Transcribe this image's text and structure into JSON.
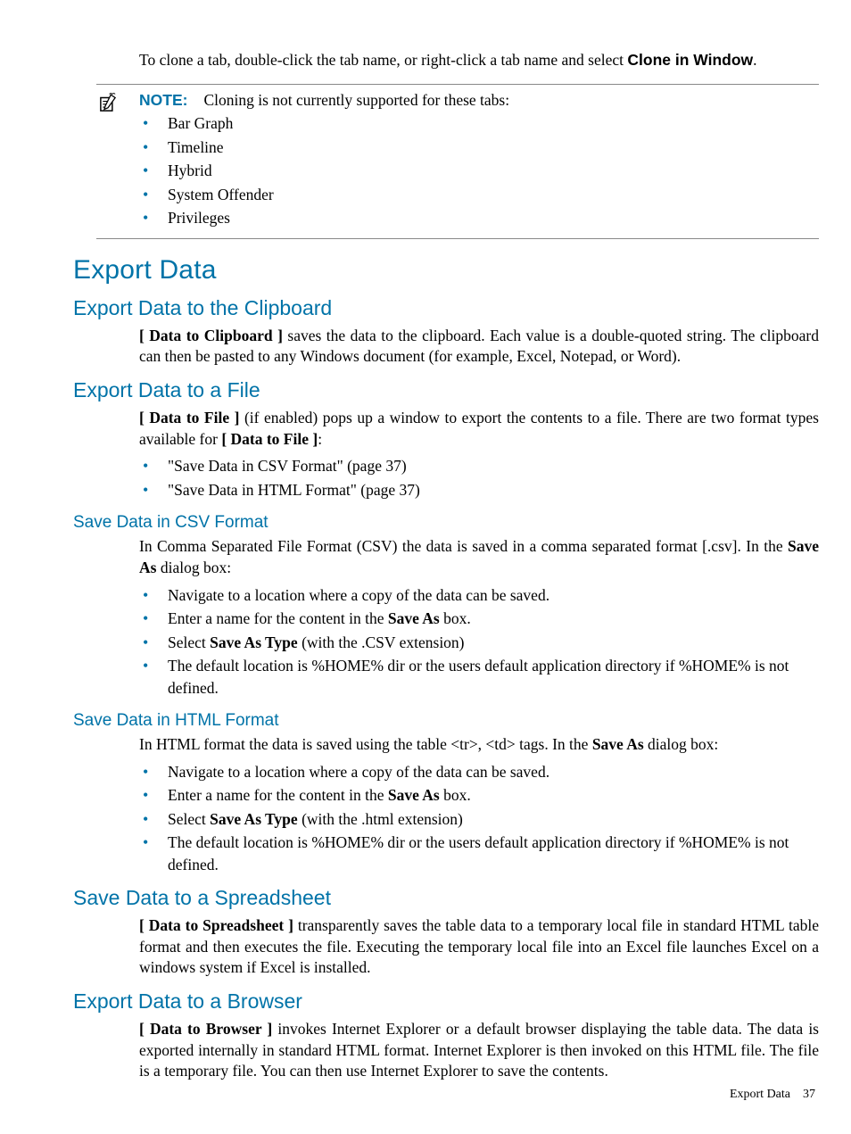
{
  "intro": {
    "prefix": "To clone a tab, double-click the tab name, or right-click a tab name and select ",
    "bold": "Clone in Window",
    "suffix": "."
  },
  "note": {
    "label": "NOTE:",
    "text": "Cloning is not currently supported for these tabs:",
    "items": [
      "Bar Graph",
      "Timeline",
      "Hybrid",
      "System Offender",
      "Privileges"
    ]
  },
  "h1_export": "Export Data",
  "clipboard": {
    "heading": "Export Data to the Clipboard",
    "bold": "[ Data to Clipboard ]",
    "rest": " saves the data to the clipboard. Each value is a double-quoted string. The clipboard can then be pasted to any Windows document (for example, Excel, Notepad, or Word)."
  },
  "file": {
    "heading": "Export Data to a File",
    "p_bold1": "[ Data to File ]",
    "p_mid": " (if enabled) pops up a window to export the contents to a file. There are two format types available for ",
    "p_bold2": "[ Data to File ]",
    "p_suffix": ":",
    "items": [
      "\"Save Data in CSV Format\" (page 37)",
      "\"Save Data in HTML Format\" (page 37)"
    ]
  },
  "csv": {
    "heading": "Save Data in CSV Format",
    "p_pre": "In Comma Separated File Format (CSV) the data is saved in a comma separated format [.csv]. In the ",
    "p_bold": "Save As",
    "p_post": " dialog box:",
    "items": {
      "i0": "Navigate to a location where a copy of the data can be saved.",
      "i1_pre": "Enter a name for the content in the ",
      "i1_bold": "Save As",
      "i1_post": " box.",
      "i2_pre": "Select ",
      "i2_bold": "Save As Type",
      "i2_post": " (with the .CSV extension)",
      "i3": "The default location is %HOME% dir or the users default application directory if %HOME% is not defined."
    }
  },
  "html": {
    "heading": "Save Data in HTML Format",
    "p_pre": "In HTML format the data is saved using the table <tr>, <td> tags. In the ",
    "p_bold": "Save As",
    "p_post": " dialog box:",
    "items": {
      "i0": "Navigate to a location where a copy of the data can be saved.",
      "i1_pre": "Enter a name for the content in the ",
      "i1_bold": "Save As",
      "i1_post": " box.",
      "i2_pre": "Select ",
      "i2_bold": "Save As Type",
      "i2_post": " (with the .html extension)",
      "i3": "The default location is %HOME% dir or the users default application directory if %HOME% is not defined."
    }
  },
  "spreadsheet": {
    "heading": "Save Data to a Spreadsheet",
    "bold": "[ Data to Spreadsheet ]",
    "rest": " transparently saves the table data to a temporary local file in standard HTML table format and then executes the file. Executing the temporary local file into an Excel file launches Excel on a windows system if Excel is installed."
  },
  "browser": {
    "heading": "Export Data to a Browser",
    "bold": "[ Data to Browser ]",
    "rest": " invokes Internet Explorer or a default browser displaying the table data. The data is exported internally in standard HTML format. Internet Explorer is then invoked on this HTML file. The file is a temporary file. You can then use Internet Explorer to save the contents."
  },
  "footer": {
    "label": "Export Data",
    "page": "37"
  }
}
